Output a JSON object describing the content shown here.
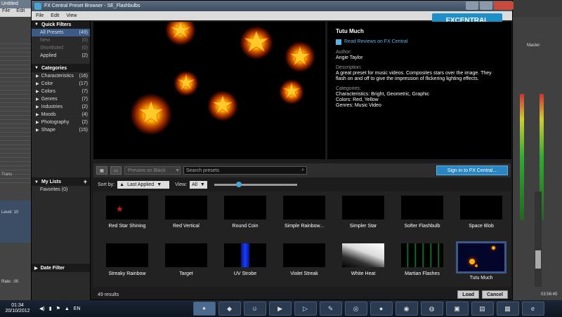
{
  "background_app": {
    "title": "Untitled",
    "menu": [
      "File",
      "Edit"
    ],
    "status_text": "Rate: .00",
    "level": "Level: 10",
    "master": "Master",
    "track": "Trans",
    "time": "03:56:45"
  },
  "window": {
    "title": "FX Central Preset Browser - SE_Flashbulbs",
    "brand": "FXCENTRAL"
  },
  "menu": [
    "File",
    "Edit",
    "View"
  ],
  "sidebar": {
    "quick_filters_title": "Quick Filters",
    "quick_filters": [
      {
        "label": "All Presets",
        "count": "(49)"
      },
      {
        "label": "New",
        "count": "(0)"
      },
      {
        "label": "Shortlisted",
        "count": "(0)"
      },
      {
        "label": "Applied",
        "count": "(2)"
      }
    ],
    "categories_title": "Categories",
    "categories": [
      {
        "label": "Characteristics",
        "count": "(16)"
      },
      {
        "label": "Color",
        "count": "(17)"
      },
      {
        "label": "Colors",
        "count": "(7)"
      },
      {
        "label": "Genres",
        "count": "(7)"
      },
      {
        "label": "Industries",
        "count": "(2)"
      },
      {
        "label": "Moods",
        "count": "(4)"
      },
      {
        "label": "Photography",
        "count": "(2)"
      },
      {
        "label": "Shape",
        "count": "(15)"
      }
    ],
    "my_lists_title": "My Lists",
    "my_lists": [
      {
        "label": "Favorites",
        "count": "(0)"
      }
    ],
    "date_filter_title": "Date Filter"
  },
  "details": {
    "title": "Tutu Much",
    "reviews_link": "Read Reviews on FX Central",
    "author_label": "Author:",
    "author": "Angie Taylor",
    "description_label": "Description:",
    "description": "A great preset for music videos. Composites stars over the image. They flash on and off to give the impression of flickering lighting effects.",
    "categories_label": "Categories:",
    "characteristics": "Characteristics: Bright, Geometric, Graphic",
    "colors": "Colors: Red, Yellow",
    "genres": "Genres: Music Video"
  },
  "toolbar": {
    "preview_select": "Preview on Black",
    "search_placeholder": "Search presets",
    "signin": "Sign in to FX Central..."
  },
  "sort": {
    "sort_label": "Sort by:",
    "sort_value": "Last Applied",
    "view_label": "View:",
    "view_value": "All",
    "zoom_level": 0.28
  },
  "presets": [
    {
      "name": "Red Star Shining",
      "style": "redstar"
    },
    {
      "name": "Red Vertical",
      "style": "black"
    },
    {
      "name": "Round Coin",
      "style": "black"
    },
    {
      "name": "Simple Rainbow...",
      "style": "black"
    },
    {
      "name": "Simpler Star",
      "style": "black"
    },
    {
      "name": "Softer Flashbulb",
      "style": "black"
    },
    {
      "name": "Space Blob",
      "style": "black"
    },
    {
      "name": "Streaky Rainbow",
      "style": "black"
    },
    {
      "name": "Target",
      "style": "black"
    },
    {
      "name": "UV Strobe",
      "style": "uv"
    },
    {
      "name": "Violet Streak",
      "style": "black"
    },
    {
      "name": "White Heat",
      "style": "white"
    },
    {
      "name": "Martian Flashes",
      "style": "green"
    },
    {
      "name": "Tutu Much",
      "style": "tutu",
      "selected": true
    }
  ],
  "status": {
    "results": "49 results",
    "load": "Load",
    "cancel": "Cancel"
  },
  "taskbar": {
    "time": "01:34",
    "date": "20/10/2012",
    "lang": "EN"
  }
}
